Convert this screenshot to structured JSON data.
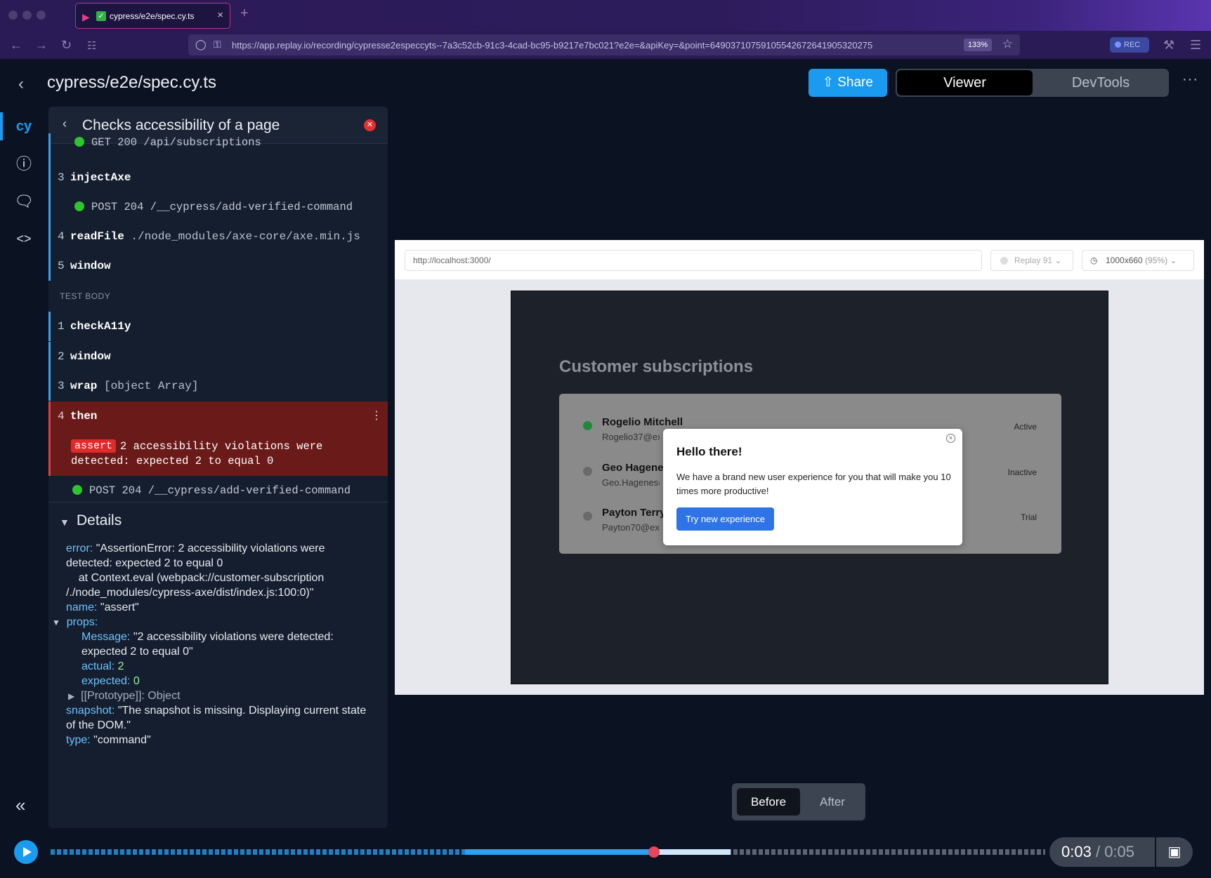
{
  "browser": {
    "tab_title": "cypress/e2e/spec.cy.ts",
    "url": "https://app.replay.io/recording/cypresse2especcyts--7a3c52cb-91c3-4cad-bc95-b9217e7bc021?e2e=&apiKey=&point=64903710759105542672641905320275",
    "url_host": "replay.io",
    "zoom": "133%",
    "rec_label": "REC"
  },
  "header": {
    "title": "cypress/e2e/spec.cy.ts",
    "share_label": "Share",
    "viewer_label": "Viewer",
    "devtools_label": "DevTools"
  },
  "panel": {
    "title": "Checks accessibility of a page",
    "partial_row": "GET 200 /api/subscriptions",
    "hook_rows": [
      {
        "num": "3",
        "cmd": "injectAxe",
        "arg": ""
      },
      {
        "num": "4",
        "cmd": "readFile",
        "arg": "./node_modules/axe-core/axe.min.js"
      },
      {
        "num": "5",
        "cmd": "window",
        "arg": ""
      }
    ],
    "hook_sub": "POST 204 /__cypress/add-verified-command",
    "section_label": "TEST BODY",
    "body_rows": [
      {
        "num": "1",
        "cmd": "checkA11y",
        "arg": ""
      },
      {
        "num": "2",
        "cmd": "window",
        "arg": ""
      },
      {
        "num": "3",
        "cmd": "wrap",
        "arg": "[object Array]"
      }
    ],
    "error_row": {
      "num": "4",
      "cmd": "then",
      "badge": "assert",
      "message": "2 accessibility violations were detected: expected 2 to equal 0"
    },
    "body_sub": "POST 204 /__cypress/add-verified-command",
    "details": {
      "heading": "Details",
      "error_key": "error:",
      "error_line1": "\"AssertionError: 2 accessibility violations were",
      "error_line2": "detected: expected 2 to equal 0",
      "error_line3": "    at Context.eval (webpack://customer-subscription",
      "error_line4": "/./node_modules/cypress-axe/dist/index.js:100:0)\"",
      "name_key": "name:",
      "name_val": "\"assert\"",
      "props_key": "props:",
      "message_key": "Message:",
      "message_line1": "\"2 accessibility violations were detected:",
      "message_line2": "expected 2 to equal 0\"",
      "actual_key": "actual:",
      "actual_val": "2",
      "expected_key": "expected:",
      "expected_val": "0",
      "prototype": "[[Prototype]]: Object",
      "snapshot_key": "snapshot:",
      "snapshot_line1": "\"The snapshot is missing. Displaying current state",
      "snapshot_line2": "of the DOM.\"",
      "type_key": "type:",
      "type_val": "\"command\""
    }
  },
  "preview": {
    "url": "http://localhost:3000/",
    "replay_label": "Replay 91",
    "size_label": "1000x660",
    "size_pct": "(95%)",
    "app_title": "Customer subscriptions",
    "customers": [
      {
        "name": "Rogelio Mitchell",
        "email": "Rogelio37@example.com",
        "status": "Active",
        "active": true
      },
      {
        "name": "Geo Hagenes",
        "email": "Geo.Hagenes@example.com",
        "status": "Inactive",
        "active": false
      },
      {
        "name": "Payton Terry",
        "email": "Payton70@example.com",
        "status": "Trial",
        "active": false
      }
    ],
    "modal": {
      "title": "Hello there!",
      "body": "We have a brand new user experience for you that will make you 10 times more productive!",
      "button": "Try new experience"
    }
  },
  "toggle": {
    "before": "Before",
    "after": "After"
  },
  "timeline": {
    "current": "0:03",
    "total": "0:05",
    "progress": 0.6
  },
  "colors": {
    "accent": "#1a9bf0",
    "error": "#6b1a1a",
    "success": "#2fc42f",
    "playhead": "#e8455a"
  }
}
